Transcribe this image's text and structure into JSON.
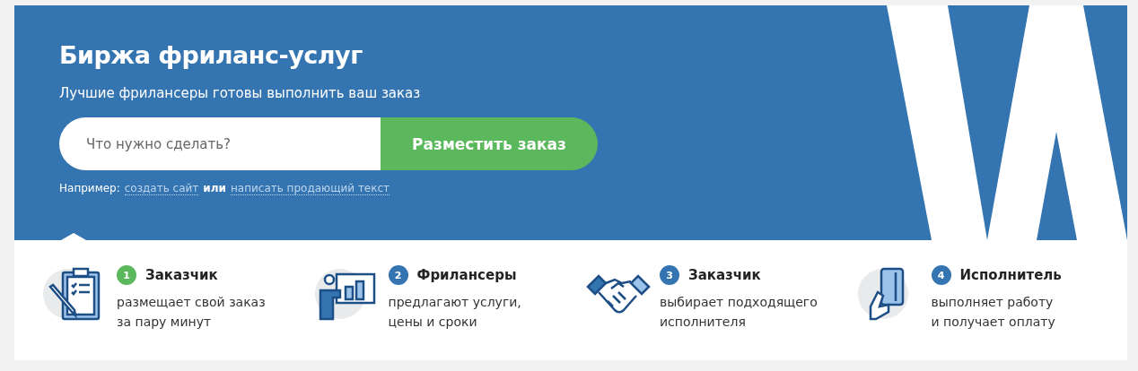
{
  "hero": {
    "title": "Биржа фриланс-услуг",
    "subtitle": "Лучшие фрилансеры готовы выполнить ваш заказ",
    "search": {
      "placeholder": "Что нужно сделать?"
    },
    "button": "Разместить заказ",
    "examples": {
      "label": "Например:",
      "links": [
        "создать сайт",
        "написать продающий текст"
      ],
      "separator": "или"
    }
  },
  "steps": [
    {
      "number": "1",
      "color": "#5cb85c",
      "title": "Заказчик",
      "lines": [
        "размещает свой заказ",
        "за пару минут"
      ]
    },
    {
      "number": "2",
      "color": "#3474b0",
      "title": "Фрилансеры",
      "lines": [
        "предлагают услуги,",
        "цены и сроки"
      ]
    },
    {
      "number": "3",
      "color": "#3474b0",
      "title": "Заказчик",
      "lines": [
        "выбирает подходящего",
        "исполнителя"
      ]
    },
    {
      "number": "4",
      "color": "#3474b0",
      "title": "Исполнитель",
      "lines": [
        "выполняет работу",
        "и получает оплату"
      ]
    }
  ]
}
